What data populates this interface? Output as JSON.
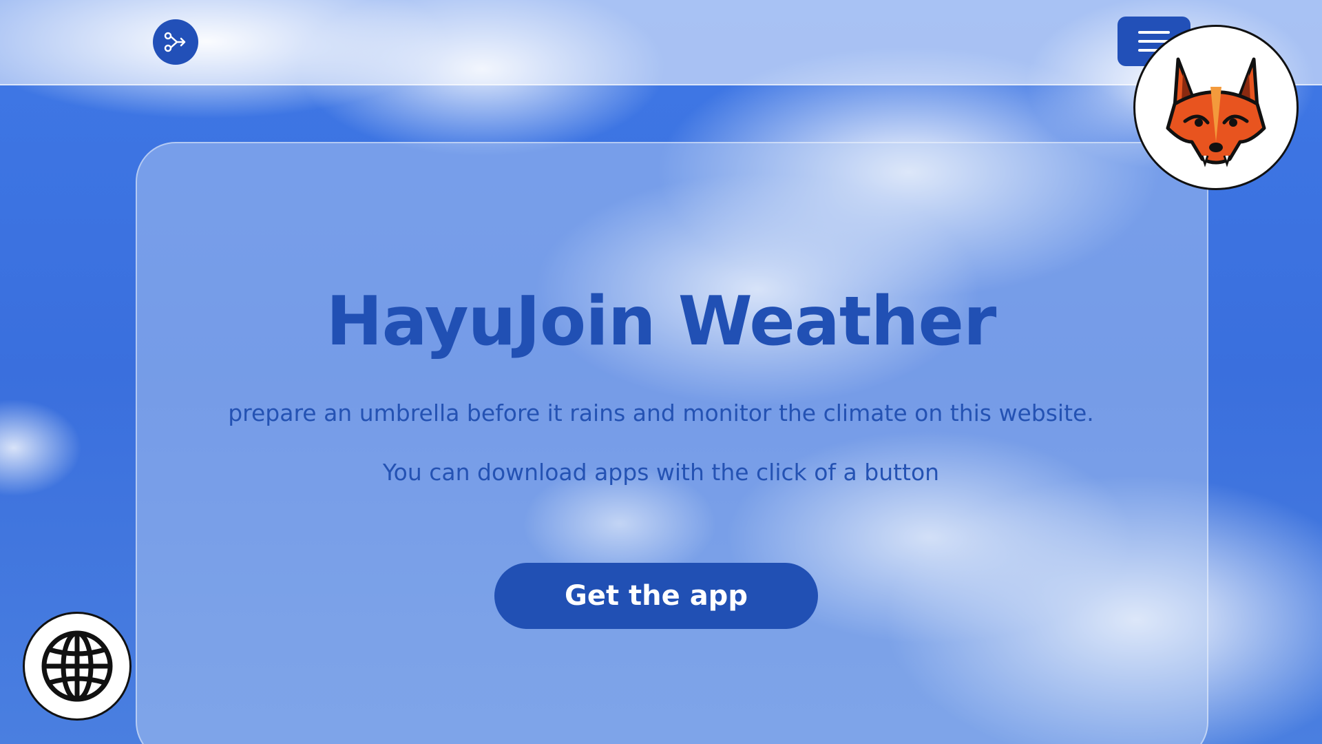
{
  "navbar": {
    "logo_icon": "share-arrow-icon",
    "menu_icon": "hamburger-menu-icon"
  },
  "hero": {
    "title": "HayuJoin Weather",
    "line1": "prepare an umbrella before it rains and monitor the climate on this website.",
    "line2": "You can download apps with the click of a button",
    "cta_label": "Get the app"
  },
  "overlays": {
    "mascot_icon": "fox-mascot-icon",
    "globe_icon": "globe-icon"
  },
  "colors": {
    "brand_blue": "#2150b4",
    "sky_blue": "#3f78e6",
    "white": "#ffffff"
  }
}
